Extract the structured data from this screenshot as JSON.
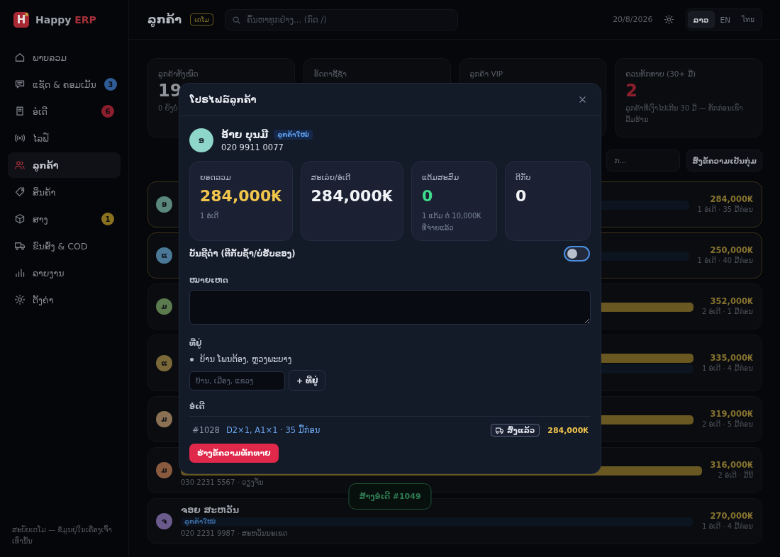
{
  "sidebar": {
    "logo": {
      "mark": "H",
      "name": "Happy",
      "accent": "ERP"
    },
    "items": [
      {
        "label": "ພາບລວມ",
        "selected": false
      },
      {
        "label": "ແຊັດ & ຄອມເມັ້ນ",
        "selected": false,
        "badge": {
          "text": "3",
          "color": "#2f5c96"
        }
      },
      {
        "label": "ອໍເດີ",
        "selected": false,
        "badge": {
          "text": "6",
          "color": "#8c1f2d"
        }
      },
      {
        "label": "ໄລຟ໌",
        "selected": false
      },
      {
        "label": "ລູກຄ້າ",
        "selected": true
      },
      {
        "label": "ສິນຄ້າ",
        "selected": false
      },
      {
        "label": "ສາງ",
        "selected": false,
        "badge": {
          "text": "1",
          "color": "#8a7220"
        }
      },
      {
        "label": "ຂົນສົ່ງ & COD",
        "selected": false
      },
      {
        "label": "ລາຍງານ",
        "selected": false
      },
      {
        "label": "ຕັ້ງຄ່າ",
        "selected": false
      }
    ],
    "footer": "ສະບັບເດໂມ — ຂໍ້ມູນຢູ່ໃນເຄື່ອງເຈົ້າເທົ່ານັ້ນ"
  },
  "topbar": {
    "title": "ລູກຄ້າ",
    "tag": "ເດໂມ",
    "search": {
      "placeholder": "ຄົ້ນຫາທຸກຢ່າງ... (ກົດ /)"
    },
    "date": "20/8/2026",
    "languages": [
      {
        "label": "ລາວ",
        "selected": true
      },
      {
        "label": "EN",
        "selected": false
      },
      {
        "label": "ไทย",
        "selected": false
      }
    ]
  },
  "stats": [
    {
      "kind": "plain",
      "label": "ລູກຄ້າທັງໝົດ",
      "value": "19",
      "note": "0 ຍັງບໍ່"
    },
    {
      "kind": "plain",
      "label": "ອັດຕາຊື້ຊ້ຳ"
    },
    {
      "kind": "plain",
      "label": "ລູກຄ້າ VIP"
    },
    {
      "kind": "alert",
      "label": "ຄວນທັກທາຍ (30+ ມື້)",
      "value": "2",
      "note": "ລູກຄ້າທີ່ເງົາໄປເກີນ 30 ມື້ — ທັກກ່ອນເຂົາລືມຮ້ານ"
    }
  ],
  "toolbar": {
    "search": {
      "placeholder": "ກ..."
    },
    "bulk_button": "ສົ່ງຂໍ້ຄວາມເປັນກຸ່ມ"
  },
  "customers": [
    {
      "initial": "ອ",
      "color": "#5b877d",
      "highlighted": true,
      "tags": [
        {
          "kind": "new"
        }
      ],
      "total": "284,000₭",
      "meta": "1 ອໍເດີ · 35 ມື້ກ່ອນ"
    },
    {
      "initial": "ແ",
      "color": "#4a7896",
      "highlighted": true,
      "tags": [
        {
          "kind": "new"
        }
      ],
      "total": "250,000₭",
      "meta": "1 ອໍເດີ · 40 ມື້ກ່ອນ"
    },
    {
      "initial": "ມ",
      "color": "#5b7a4e",
      "highlighted": false,
      "tags": [
        {
          "kind": "vip"
        }
      ],
      "total": "352,000₭",
      "meta": "2 ອໍເດີ · 1 ມື້ກ່ອນ"
    },
    {
      "initial": "ແ",
      "color": "#7a6838",
      "highlighted": false,
      "tags": [
        {
          "kind": "vip"
        },
        {
          "kind": "new"
        }
      ],
      "total": "335,000₭",
      "meta": "1 ອໍເດີ · 4 ມື້ກ່ອນ"
    },
    {
      "initial": "ມ",
      "color": "#8a7153",
      "highlighted": false,
      "tags": [
        {
          "kind": "vip"
        }
      ],
      "total": "319,000₭",
      "meta": "2 ອໍເດີ · 5 ມື້ກ່ອນ"
    },
    {
      "initial": "ມ",
      "color": "#8a5a3e",
      "highlighted": false,
      "tags": [
        {
          "kind": "vip"
        }
      ],
      "contact": "030 2231 5567 · ວຽງຈັນ",
      "total": "316,000₭",
      "meta": "2 ອໍເດີ · ມື້ນີ້"
    },
    {
      "initial": "ຈ",
      "color": "#6b5b8c",
      "highlighted": false,
      "name": "ຈອຍ ສະຫວັນ",
      "tags": [
        {
          "kind": "new",
          "label": "ລູກຄ້າໃໝ່"
        }
      ],
      "contact": "020 2231 9987 · ສະຫວັນນະເຂດ",
      "total": "270,000₭",
      "meta": "1 ອໍເດີ · 4 ມື້ກ່ອນ"
    }
  ],
  "toast": "ສ້າງອໍເດີ #1049",
  "modal": {
    "title": "ໂປຣໄຟລ໌ລູກຄ້າ",
    "customer": {
      "initial": "ອ",
      "color": "#8ed6c9",
      "name": "ອ້າຍ ບຸນມີ",
      "tag": "ລູກຄ້າໃໝ່",
      "phone": "020 9911 0077"
    },
    "tiles": [
      {
        "kind": "highlight",
        "label": "ຍອດລວມ",
        "value": "284,000₭",
        "note": "1 ອໍເດີ"
      },
      {
        "kind": "plain",
        "label": "ສະເລ່ຍ/ອໍເດີ",
        "value": "284,000₭"
      },
      {
        "kind": "positive",
        "label": "ແຕ້ມສະສົມ",
        "value": "0",
        "note": "1 ແຕ້ມ ຕໍ່ 10,000₭ ທີ່ຈ່າຍແລ້ວ"
      },
      {
        "kind": "plain",
        "label": "ຕີກັບ",
        "value": "0"
      }
    ],
    "blacklist": {
      "label": "ບັນຊີດຳ (ຕີກັບຊ້ຳ/ບໍ່ຮັບຂອງ)",
      "on": false
    },
    "notes": {
      "label": "ໝາຍເຫດ"
    },
    "addresses": {
      "label": "ທີ່ຢູ່",
      "items": [
        "ບ້ານ ໂພນຕ້ອງ, ຫຼວງພະບາງ"
      ],
      "input": {
        "placeholder": "ບ້ານ, ເມືອງ, ແຂວງ"
      },
      "add_button": "+ ທີ່ຢູ່"
    },
    "orders": {
      "label": "ອໍເດີ",
      "items": [
        {
          "number": "#1028",
          "summary": "D2×1, A1×1 · 35 ມື້ກ່ອນ",
          "status": "ສົ່ງແລ້ວ",
          "total": "284,000₭"
        }
      ]
    },
    "action_button": "ຮ່າງຂໍ້ຄວາມທັກທາຍ"
  }
}
